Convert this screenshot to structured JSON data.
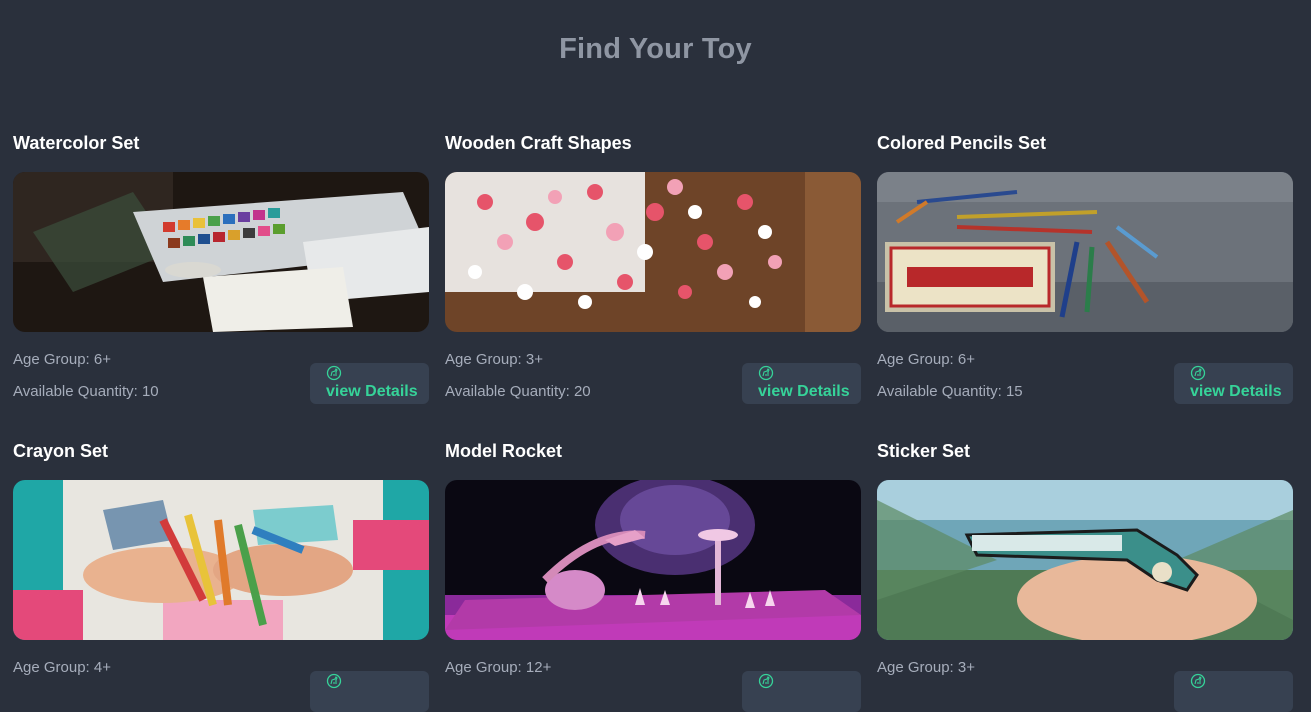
{
  "header": {
    "title": "Find Your Toy"
  },
  "labels": {
    "age_prefix": "Age Group: ",
    "qty_prefix": "Available Quantity: ",
    "details_button": "view Details"
  },
  "icons": {
    "details": "dinosaur-icon"
  },
  "colors": {
    "background": "#2a303c",
    "accent": "#36d399",
    "button_bg": "#374151"
  },
  "toys": [
    {
      "name": "Watercolor Set",
      "age": "6+",
      "quantity": "10",
      "image": "watercolor-set-photo"
    },
    {
      "name": "Wooden Craft Shapes",
      "age": "3+",
      "quantity": "20",
      "image": "wooden-hearts-photo"
    },
    {
      "name": "Colored Pencils Set",
      "age": "6+",
      "quantity": "15",
      "image": "colored-pencils-photo"
    },
    {
      "name": "Crayon Set",
      "age": "4+",
      "quantity": "",
      "image": "crayons-in-hands-photo"
    },
    {
      "name": "Model Rocket",
      "age": "12+",
      "quantity": "",
      "image": "model-rocket-photo"
    },
    {
      "name": "Sticker Set",
      "age": "3+",
      "quantity": "",
      "image": "florida-sticker-photo"
    }
  ]
}
